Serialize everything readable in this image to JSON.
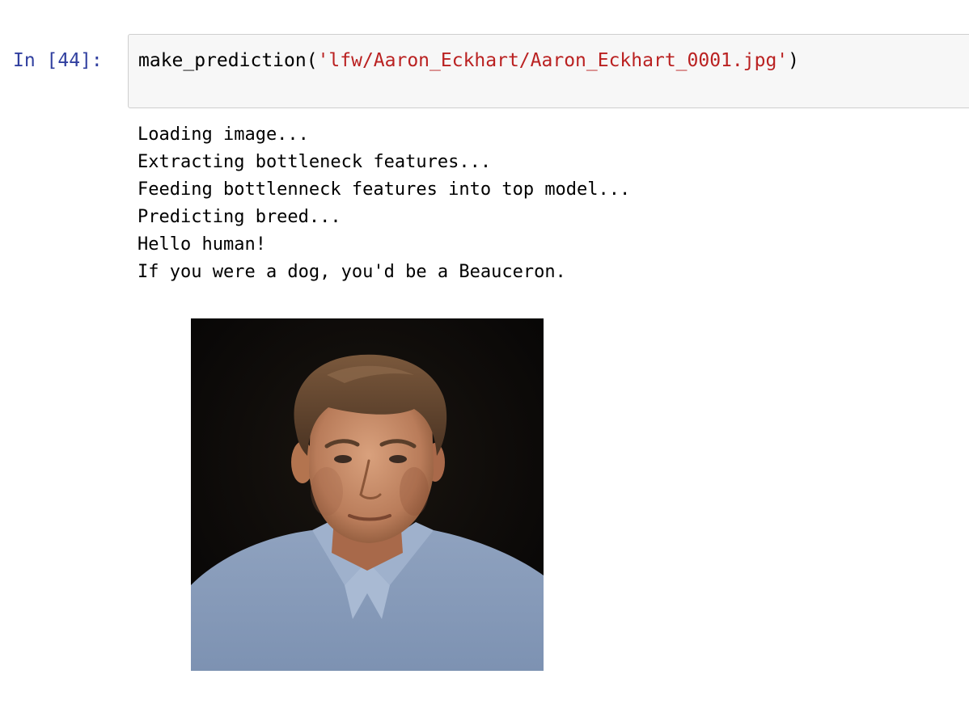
{
  "cell": {
    "prompt": "In [44]:",
    "code": {
      "function_call": "make_prediction(",
      "argument": "'lfw/Aaron_Eckhart/Aaron_Eckhart_0001.jpg'",
      "close": ")"
    }
  },
  "output": {
    "lines": [
      "Loading image...",
      "Extracting bottleneck features...",
      "Feeding bottlenneck features into top model...",
      "Predicting breed...",
      "Hello human!",
      "If you were a dog, you'd be a Beauceron."
    ]
  },
  "colors": {
    "prompt": "#303f9f",
    "string_literal": "#ba2121",
    "input_background": "#f7f7f7",
    "input_border": "#cfcfcf"
  },
  "image": {
    "icon": "portrait-photo"
  }
}
